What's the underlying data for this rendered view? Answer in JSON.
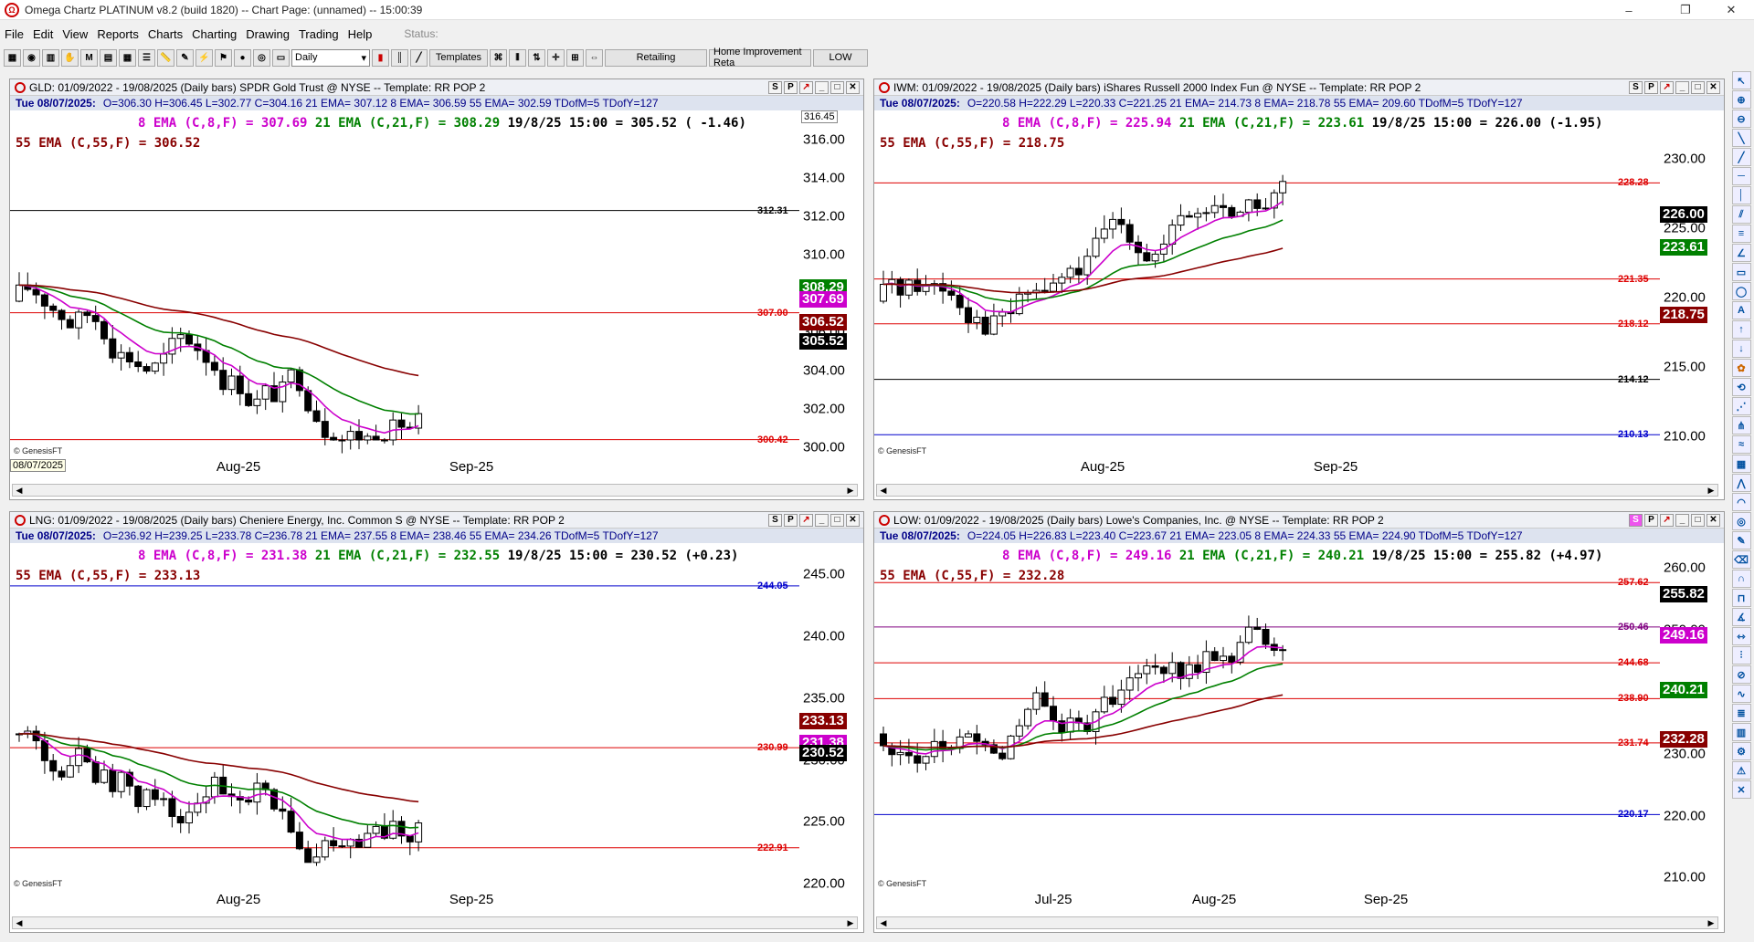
{
  "window": {
    "title": "Omega Chartz PLATINUM v8.2 (build 1820)  --  Chart Page: (unnamed)  --  15:00:39",
    "minimize": "–",
    "restore": "❐",
    "close": "✕"
  },
  "menu": {
    "items": [
      "File",
      "Edit",
      "View",
      "Reports",
      "Charts",
      "Charting",
      "Drawing",
      "Trading",
      "Help"
    ],
    "status_label": "Status:"
  },
  "toolbar": {
    "timeframe": "Daily",
    "templates_label": "Templates",
    "retailing_label": "Retailing",
    "home_improvement_label": "Home Improvement Reta",
    "low_label": "LOW"
  },
  "colors": {
    "candle_up": "#ffffff",
    "candle_down": "#000000",
    "ema8": "#cc00cc",
    "ema21": "#008000",
    "ema55": "#880000",
    "line_red": "#dd0000",
    "line_black": "#000000",
    "line_blue": "#0000cc",
    "line_purple": "#800080"
  },
  "panels": {
    "gld": {
      "header": "GLD: 01/09/2022 - 19/08/2025  (Daily bars)    SPDR Gold Trust @ NYSE  --  Template: RR POP 2",
      "stats_date": "Tue   08/07/2025:",
      "stats_ohlc": "O=306.30  H=306.45  L=302.77  C=304.16  21 EMA= 307.12  8 EMA= 306.59  55 EMA= 302.59  TDofM=5  TDofY=127",
      "ema8": "8 EMA (C,8,F) = 307.69",
      "ema21": "21 EMA (C,21,F) = 308.29",
      "ema_info": "19/8/25 15:00 = 305.52 ( -1.46)",
      "ema55": "55 EMA (C,55,F) = 306.52",
      "ticks": [
        "316.00",
        "314.00",
        "312.00",
        "310.00",
        "308.00",
        "306.00",
        "304.00",
        "302.00",
        "300.00"
      ],
      "hlines": [
        {
          "value": 312.31,
          "label": "312.31",
          "color": "black"
        },
        {
          "value": 307.0,
          "label": "307.00",
          "color": "red"
        },
        {
          "value": 300.42,
          "label": "300.42",
          "color": "red"
        }
      ],
      "badges": [
        {
          "value": 308.29,
          "label": "308.29",
          "color": "#008000"
        },
        {
          "value": 307.69,
          "label": "307.69",
          "color": "#cc00cc"
        },
        {
          "value": 306.52,
          "label": "306.52",
          "color": "#880000"
        },
        {
          "value": 305.52,
          "label": "305.52",
          "color": "#000000"
        }
      ],
      "top_badge": "316.45",
      "date_cursor": "08/07/2025",
      "dates": [
        "Aug-25",
        "Sep-25"
      ],
      "credit": "© GenesisFT"
    },
    "iwm": {
      "header": "IWM: 01/09/2022 - 19/08/2025  (Daily bars)    iShares Russell 2000 Index Fun @ NYSE  --  Template: RR POP 2",
      "stats_date": "Tue   08/07/2025:",
      "stats_ohlc": "O=220.58  H=222.29  L=220.33  C=221.25  21 EMA= 214.73  8 EMA= 218.78  55 EMA= 209.60  TDofM=5  TDofY=127",
      "ema8": "8 EMA (C,8,F) = 225.94",
      "ema21": "21 EMA (C,21,F) = 223.61",
      "ema_info": "19/8/25 15:00 = 226.00 (-1.95)",
      "ema55": "55 EMA (C,55,F) = 218.75",
      "ticks": [
        "230.00",
        "225.00",
        "220.00",
        "215.00",
        "210.00"
      ],
      "hlines": [
        {
          "value": 228.28,
          "label": "228.28",
          "color": "red"
        },
        {
          "value": 221.35,
          "label": "221.35",
          "color": "red"
        },
        {
          "value": 218.12,
          "label": "218.12",
          "color": "red"
        },
        {
          "value": 214.12,
          "label": "214.12",
          "color": "black"
        },
        {
          "value": 210.13,
          "label": "210.13",
          "color": "blue"
        }
      ],
      "badges": [
        {
          "value": 226.0,
          "label": "226.00",
          "color": "#000000"
        },
        {
          "value": 223.61,
          "label": "223.61",
          "color": "#008000"
        },
        {
          "value": 218.75,
          "label": "218.75",
          "color": "#880000"
        }
      ],
      "dates": [
        "Aug-25",
        "Sep-25"
      ],
      "credit": "© GenesisFT"
    },
    "lng": {
      "header": "LNG: 01/09/2022 - 19/08/2025  (Daily bars)    Cheniere Energy, Inc. Common S @ NYSE  --  Template: RR POP 2",
      "stats_date": "Tue   08/07/2025:",
      "stats_ohlc": "O=236.92  H=239.25  L=233.78  C=236.78  21 EMA= 237.55  8 EMA= 238.46  55 EMA= 234.26  TDofM=5  TDofY=127",
      "ema8": "8 EMA (C,8,F) = 231.38",
      "ema21": "21 EMA (C,21,F) = 232.55",
      "ema_info": "19/8/25 15:00 = 230.52 (+0.23)",
      "ema55": "55 EMA (C,55,F) = 233.13",
      "ticks": [
        "245.00",
        "240.00",
        "235.00",
        "230.00",
        "225.00",
        "220.00"
      ],
      "hlines": [
        {
          "value": 244.05,
          "label": "244.05",
          "color": "blue"
        },
        {
          "value": 230.99,
          "label": "230.99",
          "color": "red"
        },
        {
          "value": 222.91,
          "label": "222.91",
          "color": "red"
        }
      ],
      "badges": [
        {
          "value": 233.13,
          "label": "233.13",
          "color": "#880000"
        },
        {
          "value": 231.38,
          "label": "231.38",
          "color": "#cc00cc"
        },
        {
          "value": 230.52,
          "label": "230.52",
          "color": "#000000"
        }
      ],
      "dates": [
        "Aug-25",
        "Sep-25"
      ],
      "credit": "© GenesisFT"
    },
    "low": {
      "header": "LOW: 01/09/2022 - 19/08/2025  (Daily bars)    Lowe's Companies, Inc. @ NYSE  --  Template: RR POP 2",
      "stats_date": "Tue   08/07/2025:",
      "stats_ohlc": "O=224.05  H=226.83  L=223.40  C=223.67  21 EMA= 223.05  8 EMA= 224.33  55 EMA= 224.90  TDofM=5  TDofY=127",
      "ema8": "8 EMA (C,8,F) = 249.16",
      "ema21": "21 EMA (C,21,F) = 240.21",
      "ema_info": "19/8/25 15:00 = 255.82 (+4.97)",
      "ema55": "55 EMA (C,55,F) = 232.28",
      "ticks": [
        "260.00",
        "250.00",
        "240.00",
        "230.00",
        "220.00",
        "210.00"
      ],
      "hlines": [
        {
          "value": 257.62,
          "label": "257.62",
          "color": "red"
        },
        {
          "value": 250.46,
          "label": "250.46",
          "color": "purple"
        },
        {
          "value": 244.68,
          "label": "244.68",
          "color": "red"
        },
        {
          "value": 238.9,
          "label": "238.90",
          "color": "red"
        },
        {
          "value": 231.74,
          "label": "231.74",
          "color": "red"
        },
        {
          "value": 220.17,
          "label": "220.17",
          "color": "blue"
        }
      ],
      "badges": [
        {
          "value": 255.82,
          "label": "255.82",
          "color": "#000000"
        },
        {
          "value": 249.16,
          "label": "249.16",
          "color": "#cc00cc"
        },
        {
          "value": 240.21,
          "label": "240.21",
          "color": "#008000"
        },
        {
          "value": 232.28,
          "label": "232.28",
          "color": "#880000"
        }
      ],
      "dates": [
        "Jul-25",
        "Aug-25",
        "Sep-25"
      ],
      "credit": "© GenesisFT"
    }
  }
}
